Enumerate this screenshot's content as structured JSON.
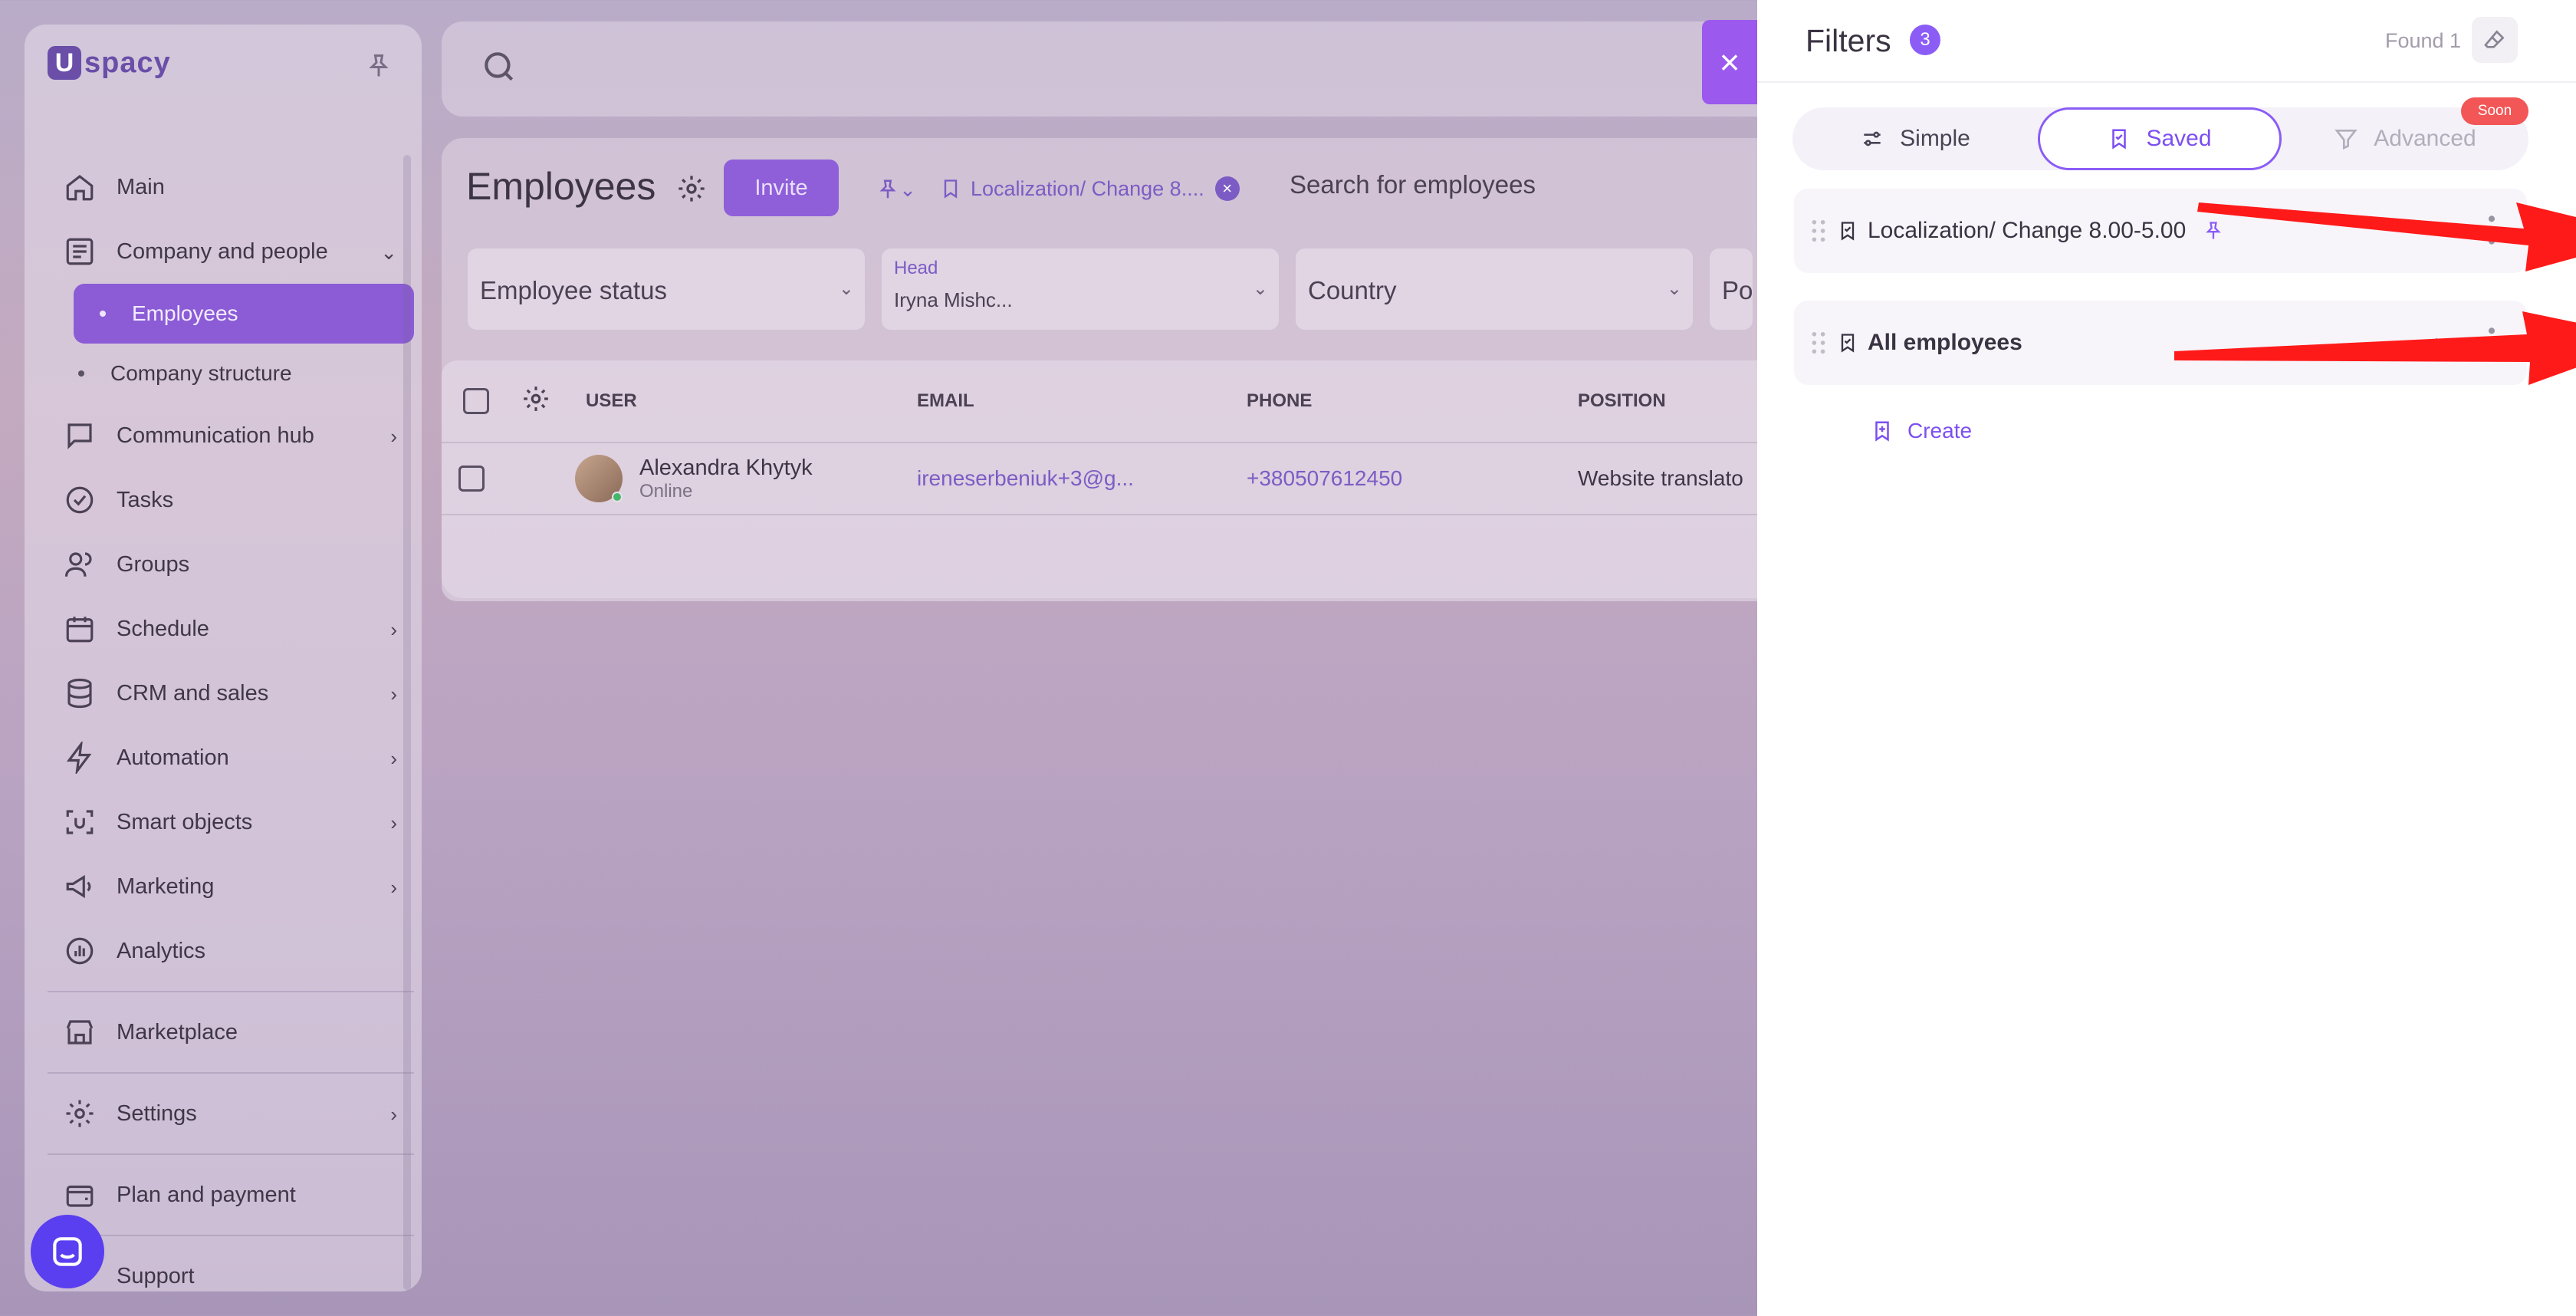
{
  "brand": {
    "logo_letter": "U",
    "logo_text": "spacy"
  },
  "sidebar": {
    "items": [
      {
        "label": "Main",
        "icon": "home-icon"
      },
      {
        "label": "Company and people",
        "icon": "building-icon",
        "expanded": true
      },
      {
        "label": "Communication hub",
        "icon": "chat-icon"
      },
      {
        "label": "Tasks",
        "icon": "check-circle-icon"
      },
      {
        "label": "Groups",
        "icon": "users-icon"
      },
      {
        "label": "Schedule",
        "icon": "calendar-icon"
      },
      {
        "label": "CRM and sales",
        "icon": "database-icon"
      },
      {
        "label": "Automation",
        "icon": "bolt-icon"
      },
      {
        "label": "Smart objects",
        "icon": "scan-icon"
      },
      {
        "label": "Marketing",
        "icon": "megaphone-icon"
      },
      {
        "label": "Analytics",
        "icon": "chart-icon"
      },
      {
        "label": "Marketplace",
        "icon": "store-icon"
      },
      {
        "label": "Settings",
        "icon": "gear-icon"
      },
      {
        "label": "Plan and payment",
        "icon": "wallet-icon"
      },
      {
        "label": "Support",
        "icon": "support-icon"
      }
    ],
    "sub_items": [
      {
        "label": "Employees",
        "active": true
      },
      {
        "label": "Company structure",
        "active": false
      }
    ]
  },
  "main": {
    "title": "Employees",
    "invite_label": "Invite",
    "chip_label": "Localization/ Change 8....",
    "search_placeholder": "Search for employees",
    "filters": {
      "status": "Employee status",
      "head_label": "Head",
      "head_value": "Iryna Mishc...",
      "country": "Country",
      "cut": "Po"
    },
    "table": {
      "columns": [
        "USER",
        "EMAIL",
        "PHONE",
        "POSITION"
      ],
      "rows": [
        {
          "name": "Alexandra Khytyk",
          "status": "Online",
          "email": "ireneserbeniuk+3@g...",
          "phone": "+380507612450",
          "position": "Website translato"
        }
      ]
    }
  },
  "filters_panel": {
    "title": "Filters",
    "count": "3",
    "found": "Found 1",
    "tabs": {
      "simple": "Simple",
      "saved": "Saved",
      "advanced": "Advanced"
    },
    "soon_badge": "Soon",
    "saved_items": [
      {
        "label": "Localization/ Change 8.00-5.00",
        "pinned": true
      },
      {
        "label": "All employees",
        "pinned": false
      }
    ],
    "create_label": "Create"
  },
  "colors": {
    "accent": "#8b5cf6",
    "arrow": "#ff1a1a",
    "soon": "#f25656"
  }
}
